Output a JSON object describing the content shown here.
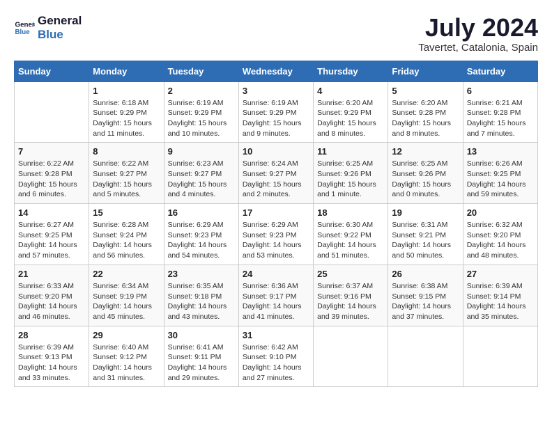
{
  "logo": {
    "line1": "General",
    "line2": "Blue"
  },
  "title": "July 2024",
  "location": "Tavertet, Catalonia, Spain",
  "weekdays": [
    "Sunday",
    "Monday",
    "Tuesday",
    "Wednesday",
    "Thursday",
    "Friday",
    "Saturday"
  ],
  "weeks": [
    [
      {
        "day": "",
        "sunrise": "",
        "sunset": "",
        "daylight": ""
      },
      {
        "day": "1",
        "sunrise": "Sunrise: 6:18 AM",
        "sunset": "Sunset: 9:29 PM",
        "daylight": "Daylight: 15 hours and 11 minutes."
      },
      {
        "day": "2",
        "sunrise": "Sunrise: 6:19 AM",
        "sunset": "Sunset: 9:29 PM",
        "daylight": "Daylight: 15 hours and 10 minutes."
      },
      {
        "day": "3",
        "sunrise": "Sunrise: 6:19 AM",
        "sunset": "Sunset: 9:29 PM",
        "daylight": "Daylight: 15 hours and 9 minutes."
      },
      {
        "day": "4",
        "sunrise": "Sunrise: 6:20 AM",
        "sunset": "Sunset: 9:29 PM",
        "daylight": "Daylight: 15 hours and 8 minutes."
      },
      {
        "day": "5",
        "sunrise": "Sunrise: 6:20 AM",
        "sunset": "Sunset: 9:28 PM",
        "daylight": "Daylight: 15 hours and 8 minutes."
      },
      {
        "day": "6",
        "sunrise": "Sunrise: 6:21 AM",
        "sunset": "Sunset: 9:28 PM",
        "daylight": "Daylight: 15 hours and 7 minutes."
      }
    ],
    [
      {
        "day": "7",
        "sunrise": "Sunrise: 6:22 AM",
        "sunset": "Sunset: 9:28 PM",
        "daylight": "Daylight: 15 hours and 6 minutes."
      },
      {
        "day": "8",
        "sunrise": "Sunrise: 6:22 AM",
        "sunset": "Sunset: 9:27 PM",
        "daylight": "Daylight: 15 hours and 5 minutes."
      },
      {
        "day": "9",
        "sunrise": "Sunrise: 6:23 AM",
        "sunset": "Sunset: 9:27 PM",
        "daylight": "Daylight: 15 hours and 4 minutes."
      },
      {
        "day": "10",
        "sunrise": "Sunrise: 6:24 AM",
        "sunset": "Sunset: 9:27 PM",
        "daylight": "Daylight: 15 hours and 2 minutes."
      },
      {
        "day": "11",
        "sunrise": "Sunrise: 6:25 AM",
        "sunset": "Sunset: 9:26 PM",
        "daylight": "Daylight: 15 hours and 1 minute."
      },
      {
        "day": "12",
        "sunrise": "Sunrise: 6:25 AM",
        "sunset": "Sunset: 9:26 PM",
        "daylight": "Daylight: 15 hours and 0 minutes."
      },
      {
        "day": "13",
        "sunrise": "Sunrise: 6:26 AM",
        "sunset": "Sunset: 9:25 PM",
        "daylight": "Daylight: 14 hours and 59 minutes."
      }
    ],
    [
      {
        "day": "14",
        "sunrise": "Sunrise: 6:27 AM",
        "sunset": "Sunset: 9:25 PM",
        "daylight": "Daylight: 14 hours and 57 minutes."
      },
      {
        "day": "15",
        "sunrise": "Sunrise: 6:28 AM",
        "sunset": "Sunset: 9:24 PM",
        "daylight": "Daylight: 14 hours and 56 minutes."
      },
      {
        "day": "16",
        "sunrise": "Sunrise: 6:29 AM",
        "sunset": "Sunset: 9:23 PM",
        "daylight": "Daylight: 14 hours and 54 minutes."
      },
      {
        "day": "17",
        "sunrise": "Sunrise: 6:29 AM",
        "sunset": "Sunset: 9:23 PM",
        "daylight": "Daylight: 14 hours and 53 minutes."
      },
      {
        "day": "18",
        "sunrise": "Sunrise: 6:30 AM",
        "sunset": "Sunset: 9:22 PM",
        "daylight": "Daylight: 14 hours and 51 minutes."
      },
      {
        "day": "19",
        "sunrise": "Sunrise: 6:31 AM",
        "sunset": "Sunset: 9:21 PM",
        "daylight": "Daylight: 14 hours and 50 minutes."
      },
      {
        "day": "20",
        "sunrise": "Sunrise: 6:32 AM",
        "sunset": "Sunset: 9:20 PM",
        "daylight": "Daylight: 14 hours and 48 minutes."
      }
    ],
    [
      {
        "day": "21",
        "sunrise": "Sunrise: 6:33 AM",
        "sunset": "Sunset: 9:20 PM",
        "daylight": "Daylight: 14 hours and 46 minutes."
      },
      {
        "day": "22",
        "sunrise": "Sunrise: 6:34 AM",
        "sunset": "Sunset: 9:19 PM",
        "daylight": "Daylight: 14 hours and 45 minutes."
      },
      {
        "day": "23",
        "sunrise": "Sunrise: 6:35 AM",
        "sunset": "Sunset: 9:18 PM",
        "daylight": "Daylight: 14 hours and 43 minutes."
      },
      {
        "day": "24",
        "sunrise": "Sunrise: 6:36 AM",
        "sunset": "Sunset: 9:17 PM",
        "daylight": "Daylight: 14 hours and 41 minutes."
      },
      {
        "day": "25",
        "sunrise": "Sunrise: 6:37 AM",
        "sunset": "Sunset: 9:16 PM",
        "daylight": "Daylight: 14 hours and 39 minutes."
      },
      {
        "day": "26",
        "sunrise": "Sunrise: 6:38 AM",
        "sunset": "Sunset: 9:15 PM",
        "daylight": "Daylight: 14 hours and 37 minutes."
      },
      {
        "day": "27",
        "sunrise": "Sunrise: 6:39 AM",
        "sunset": "Sunset: 9:14 PM",
        "daylight": "Daylight: 14 hours and 35 minutes."
      }
    ],
    [
      {
        "day": "28",
        "sunrise": "Sunrise: 6:39 AM",
        "sunset": "Sunset: 9:13 PM",
        "daylight": "Daylight: 14 hours and 33 minutes."
      },
      {
        "day": "29",
        "sunrise": "Sunrise: 6:40 AM",
        "sunset": "Sunset: 9:12 PM",
        "daylight": "Daylight: 14 hours and 31 minutes."
      },
      {
        "day": "30",
        "sunrise": "Sunrise: 6:41 AM",
        "sunset": "Sunset: 9:11 PM",
        "daylight": "Daylight: 14 hours and 29 minutes."
      },
      {
        "day": "31",
        "sunrise": "Sunrise: 6:42 AM",
        "sunset": "Sunset: 9:10 PM",
        "daylight": "Daylight: 14 hours and 27 minutes."
      },
      {
        "day": "",
        "sunrise": "",
        "sunset": "",
        "daylight": ""
      },
      {
        "day": "",
        "sunrise": "",
        "sunset": "",
        "daylight": ""
      },
      {
        "day": "",
        "sunrise": "",
        "sunset": "",
        "daylight": ""
      }
    ]
  ]
}
